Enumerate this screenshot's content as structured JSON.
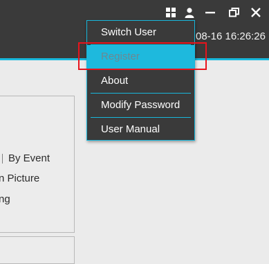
{
  "header": {
    "datetime": "08-16 16:26:26",
    "icons": [
      "grid-icon",
      "user-icon",
      "minimize-icon",
      "restore-icon",
      "close-icon"
    ]
  },
  "panel": {
    "separator_text": "By Event",
    "line2": "n Picture",
    "line3": "ng"
  },
  "user_menu": {
    "items": [
      {
        "label": "Switch User",
        "state": "normal"
      },
      {
        "label": "Register",
        "state": "highlighted"
      },
      {
        "label": "About",
        "state": "normal"
      },
      {
        "label": "Modify Password",
        "state": "normal"
      },
      {
        "label": "User Manual",
        "state": "normal"
      }
    ]
  },
  "colors": {
    "titlebar": "#3a3a3a",
    "accent": "#18b8dc",
    "menu_hover": "#1eb9dd",
    "annotation": "#e8141c"
  }
}
